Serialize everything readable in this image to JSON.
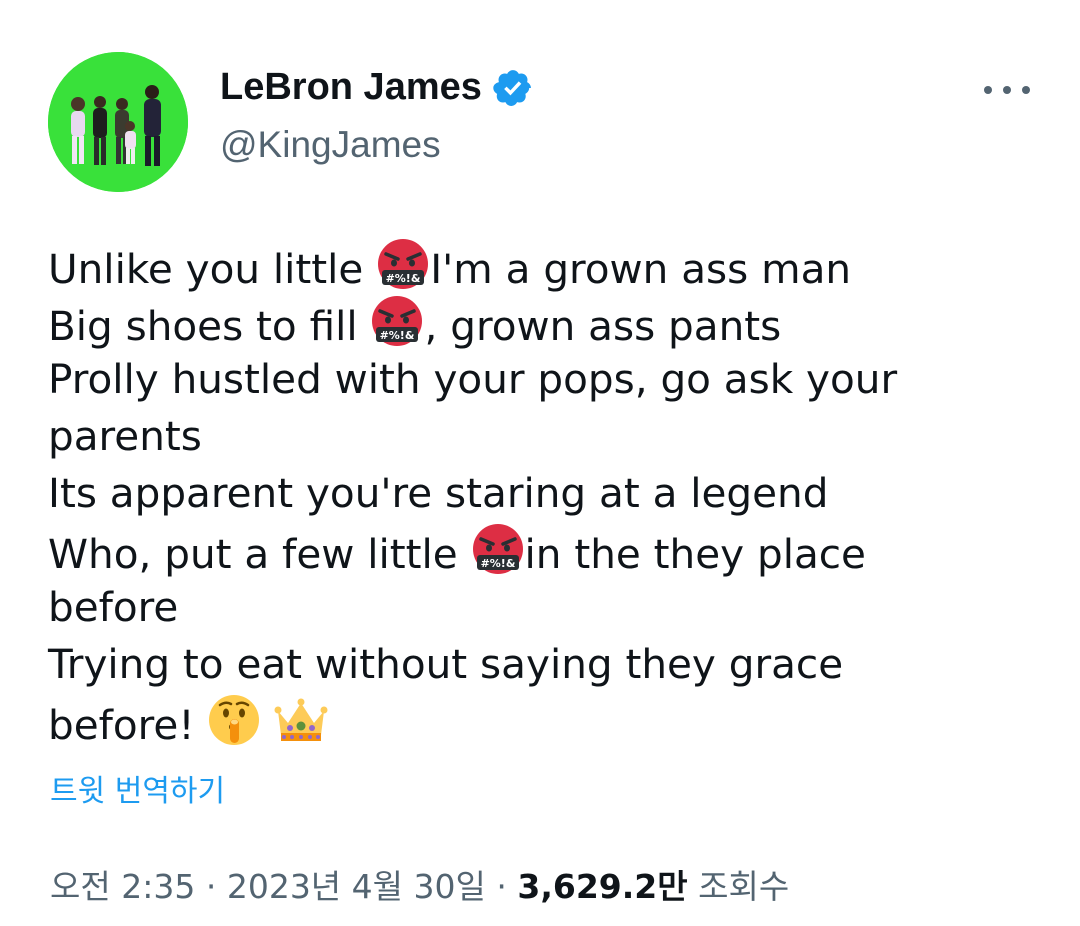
{
  "user": {
    "display_name": "LeBron James",
    "handle": "@KingJames",
    "verified": true
  },
  "tweet": {
    "lines": [
      {
        "a": "Unlike you little ",
        "emoji": "cursing-face",
        "b": "I'm a grown ass man"
      },
      {
        "a": "Big shoes to fill ",
        "emoji": "cursing-face",
        "b": ", grown ass pants"
      },
      {
        "a": "Prolly hustled with your pops, go ask your"
      },
      {
        "a": "parents"
      },
      {
        "a": "Its apparent you're staring at a legend"
      },
      {
        "a": "Who, put a few little ",
        "emoji": "cursing-face",
        "b": "in the they place"
      },
      {
        "a": "before"
      },
      {
        "a": "Trying to eat without saying they grace"
      },
      {
        "a": "before! ",
        "emoji": "shushing-face",
        "emoji2": "crown"
      }
    ]
  },
  "translate_label": "트윗 번역하기",
  "meta": {
    "time": "오전 2:35",
    "sep": "·",
    "date": "2023년 4월 30일",
    "views_count": "3,629.2만",
    "views_label": "조회수"
  },
  "colors": {
    "accent": "#1d9bf0",
    "secondary_text": "#536471",
    "text": "#0f1419",
    "avatar_bg": "#39e13a"
  },
  "icons": {
    "verified": "verified-badge-icon",
    "more": "more-horizontal-icon"
  }
}
